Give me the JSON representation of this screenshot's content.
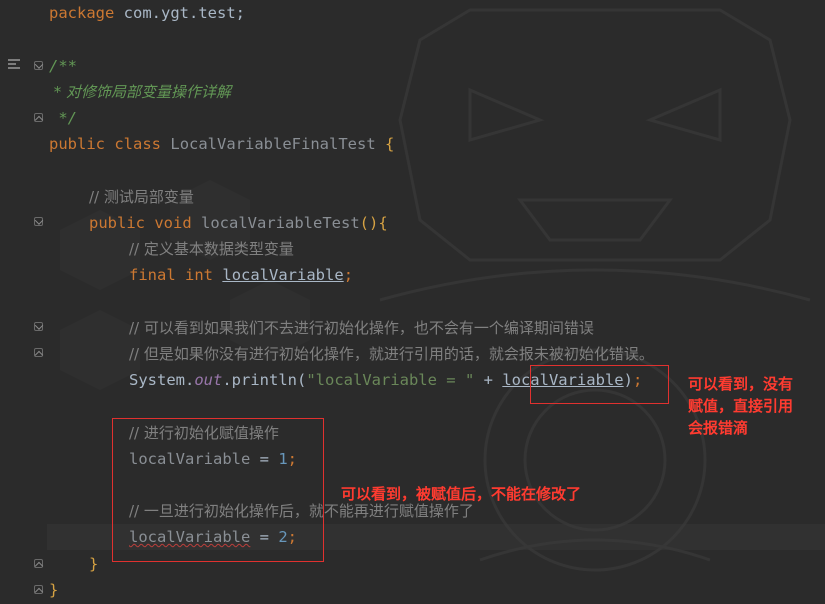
{
  "editor": {
    "lines": {
      "l1": {
        "kw": "package",
        "rest": "com.ygt.test;"
      },
      "l3": {
        "text": "/**"
      },
      "l4": {
        "text": " * 对修饰局部变量操作详解"
      },
      "l5": {
        "text": " */"
      },
      "l6": {
        "kw1": "public",
        "kw2": "class",
        "name": "LocalVariableFinalTest",
        "brace": "{"
      },
      "l8": {
        "text": "// 测试局部变量"
      },
      "l9": {
        "kw1": "public",
        "kw2": "void",
        "name": "localVariableTest",
        "rest": "(){"
      },
      "l10": {
        "text": "// 定义基本数据类型变量"
      },
      "l11": {
        "kw1": "final",
        "kw2": "int",
        "var": "localVariable",
        "semi": ";"
      },
      "l13": {
        "text": "// 可以看到如果我们不去进行初始化操作，也不会有一个编译期间错误"
      },
      "l14": {
        "text": "// 但是如果你没有进行初始化操作，就进行引用的话，就会报未被初始化错误。"
      },
      "l15": {
        "sys": "System.",
        "field": "out",
        "call": ".println(",
        "str": "\"localVariable = \"",
        "plus": " + ",
        "var": "localVariable",
        "close": ")",
        "semi": ";"
      },
      "l16": {
        "text": "// 进行初始化赋值操作"
      },
      "l17": {
        "var": "localVariable",
        "op": " = ",
        "num": "1",
        "semi": ";"
      },
      "l19": {
        "text": "// 一旦进行初始化操作后，就不能再进行赋值操作了"
      },
      "l20": {
        "var": "localVariable",
        "op": " = ",
        "num": "2",
        "semi": ";"
      },
      "l21": {
        "text": "}"
      },
      "l22": {
        "text": "}"
      }
    }
  },
  "annotations": {
    "right_note": [
      "可以看到，没有",
      "赋值，直接引用",
      "会报错滴"
    ],
    "middle_note": "可以看到，被赋值后，不能在修改了"
  },
  "colors": {
    "keyword": "#cc7832",
    "doc_comment": "#629755",
    "line_comment": "#808080",
    "number": "#6897bb",
    "string": "#6a8759",
    "annotation_red": "#ff3b30",
    "background": "#2b2b2b"
  }
}
